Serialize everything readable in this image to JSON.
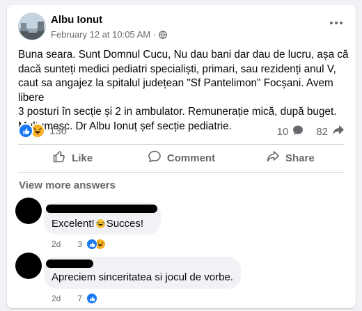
{
  "post": {
    "author": "Albu Ionut",
    "timestamp": "February 12 at 10:05 AM",
    "separator": "·",
    "privacy_icon": "globe-icon",
    "text": "Buna seara. Sunt Domnul Cucu, Nu dau bani dar dau de lucru, așa că\ndacă sunteți medici pediatri specialiști, primari, sau rezidenți anul V,\ncaut sa angajez la spitalul județean \"Sf Pantelimon\" Focșani. Avem libere\n3 posturi în secție și 2 in ambulator. Remunerație mică, după buget.\nMulțumesc. Dr Albu Ionuț șef secție pediatrie.",
    "reaction_count": "136",
    "comment_count": "10",
    "share_count": "82"
  },
  "actions": {
    "like": "Like",
    "comment": "Comment",
    "share": "Share"
  },
  "comments_section": {
    "view_more": "View more answers",
    "items": [
      {
        "text_before": "Excelent!",
        "text_after": " Succes!",
        "time": "2d",
        "reaction_count": "3"
      },
      {
        "text": "Apreciem sinceritatea si jocul de vorbe.",
        "time": "2d",
        "reaction_count": "7"
      }
    ]
  },
  "colors": {
    "accent": "#1877f2",
    "haha": "#f7b125",
    "secondary_text": "#65676b"
  }
}
